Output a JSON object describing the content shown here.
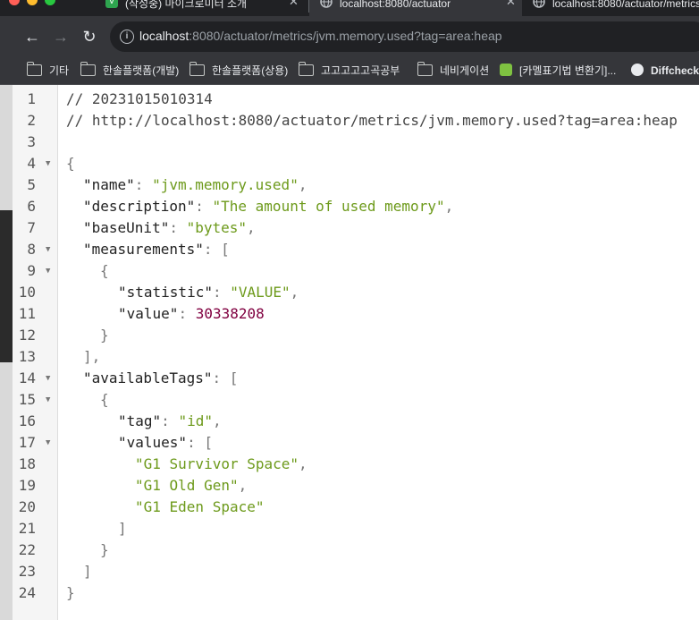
{
  "browser": {
    "tabs": [
      {
        "label": "(작성중) 마이크로미터 소개",
        "active": false
      },
      {
        "label": "localhost:8080/actuator",
        "active": true
      },
      {
        "label": "localhost:8080/actuator/metrics",
        "active": false
      }
    ],
    "url_host": "localhost",
    "url_rest": ":8080/actuator/metrics/jvm.memory.used?tag=area:heap",
    "bookmarks": [
      {
        "label": "기타",
        "icon": "folder-icon"
      },
      {
        "label": "한솔플랫폼(개발)",
        "icon": "folder-icon"
      },
      {
        "label": "한솔플랫폼(상용)",
        "icon": "folder-icon"
      },
      {
        "label": "고고고고고곡공부",
        "icon": "folder-icon"
      },
      {
        "label": "네비게이션",
        "icon": "folder-icon"
      },
      {
        "label": "[카멜표기법 변환기]...",
        "icon": "app-icon"
      },
      {
        "label": "Diffcheck",
        "icon": "diffchecker-icon"
      }
    ],
    "colors": {
      "tab_bar": "#202124",
      "toolbar": "#35363a",
      "accent_green": "#6d9a1b"
    }
  },
  "json_viewer": {
    "comment_timestamp": "// 20231015010314",
    "comment_url": "// http://localhost:8080/actuator/metrics/jvm.memory.used?tag=area:heap",
    "name_key": "\"name\"",
    "name_value": "\"jvm.memory.used\"",
    "description_key": "\"description\"",
    "description_value": "\"The amount of used memory\"",
    "baseUnit_key": "\"baseUnit\"",
    "baseUnit_value": "\"bytes\"",
    "measurements_key": "\"measurements\"",
    "statistic_key": "\"statistic\"",
    "statistic_value": "\"VALUE\"",
    "value_key": "\"value\"",
    "value_value": "30338208",
    "availableTags_key": "\"availableTags\"",
    "tag_key": "\"tag\"",
    "tag_value": "\"id\"",
    "values_key": "\"values\"",
    "values": [
      "\"G1 Survivor Space\"",
      "\"G1 Old Gen\"",
      "\"G1 Eden Space\""
    ],
    "line_numbers": [
      "1",
      "2",
      "3",
      "4",
      "5",
      "6",
      "7",
      "8",
      "9",
      "10",
      "11",
      "12",
      "13",
      "14",
      "15",
      "16",
      "17",
      "18",
      "19",
      "20",
      "21",
      "22",
      "23",
      "24"
    ]
  }
}
